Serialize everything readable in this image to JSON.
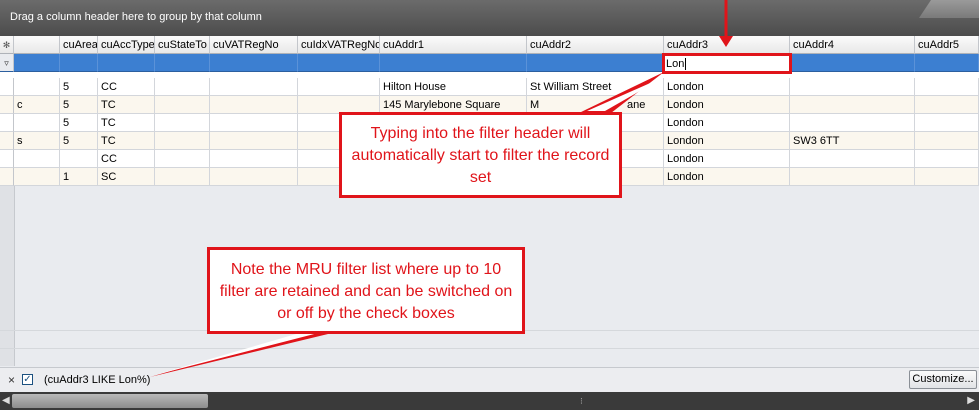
{
  "group_panel": {
    "hint": "Drag a column header here to group by that column"
  },
  "grid": {
    "columns": [
      "cuArea",
      "cuAccType",
      "cuStateTo",
      "cuVATRegNo",
      "cuIdxVATRegNo",
      "cuAddr1",
      "cuAddr2",
      "cuAddr3",
      "cuAddr4",
      "cuAddr5"
    ],
    "filter_value": "Lon",
    "rows": [
      {
        "prefix": "",
        "cuArea": "5",
        "cuAccType": "CC",
        "cuAddr1": "Hilton House",
        "cuAddr2": "St William Street",
        "cuAddr3": "London",
        "cuAddr4": ""
      },
      {
        "prefix": "c",
        "cuArea": "5",
        "cuAccType": "TC",
        "cuAddr1": "145 Marylebone Square",
        "cuAddr2": "M",
        "cuAddr2_tail": "ane",
        "cuAddr3": "London",
        "cuAddr4": ""
      },
      {
        "prefix": "",
        "cuArea": "5",
        "cuAccType": "TC",
        "cuAddr1": "",
        "cuAddr2": "",
        "cuAddr3": "London",
        "cuAddr4": ""
      },
      {
        "prefix": "s",
        "cuArea": "5",
        "cuAccType": "TC",
        "cuAddr1": "",
        "cuAddr2": "",
        "cuAddr3": "London",
        "cuAddr4": "SW3 6TT"
      },
      {
        "prefix": "",
        "cuArea": "",
        "cuAccType": "CC",
        "cuAddr1": "",
        "cuAddr2": "",
        "cuAddr3": "London",
        "cuAddr4": ""
      },
      {
        "prefix": "",
        "cuArea": "1",
        "cuAccType": "SC",
        "cuAddr1": "",
        "cuAddr2": "",
        "cuAddr3": "London",
        "cuAddr4": ""
      }
    ]
  },
  "annotations": {
    "filter_callout": "Typing into the filter header will automatically start to filter the record set",
    "mru_callout": "Note the MRU filter list where up to 10 filter are retained and can be switched on or off by the check boxes"
  },
  "mru_bar": {
    "filter_text": "(cuAddr3 LIKE Lon%)",
    "checked": true,
    "customize_label": "Customize..."
  },
  "colors": {
    "annotation_red": "#e0141a",
    "filter_row_blue": "#3c7fd1",
    "group_panel": "#5a5a5a"
  }
}
